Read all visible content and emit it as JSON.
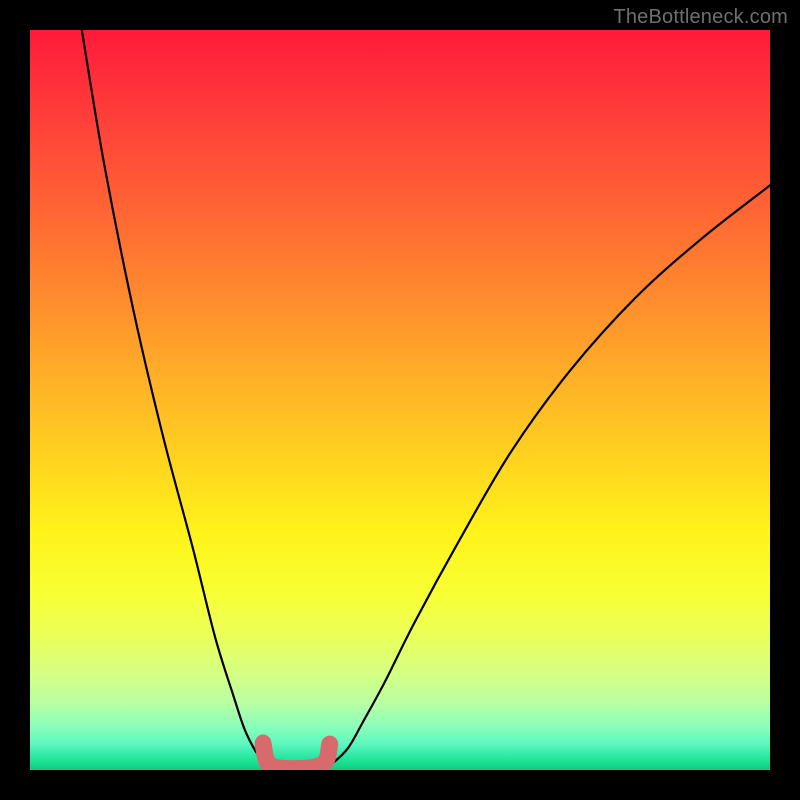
{
  "watermark": "TheBottleneck.com",
  "colors": {
    "background": "#000000",
    "curve": "#000000",
    "marker": "#d86a6d",
    "gradient_top": "#ff1a3a",
    "gradient_mid": "#fff31a",
    "gradient_bottom": "#14c97f"
  },
  "chart_data": {
    "type": "line",
    "title": "",
    "xlabel": "",
    "ylabel": "",
    "xlim": [
      0,
      100
    ],
    "ylim": [
      0,
      100
    ],
    "grid": false,
    "annotations": [],
    "series": [
      {
        "name": "left-curve",
        "x": [
          7,
          10,
          14,
          18,
          22,
          25,
          27.5,
          29,
          30.5,
          31.5,
          32,
          32.5
        ],
        "y": [
          100,
          82,
          62,
          45,
          30,
          18,
          10,
          5.5,
          2.5,
          1.2,
          0.7,
          0.5
        ]
      },
      {
        "name": "right-curve",
        "x": [
          40,
          41,
          43,
          45,
          48,
          52,
          58,
          65,
          73,
          82,
          91,
          100
        ],
        "y": [
          0.5,
          1.0,
          3.0,
          6.5,
          12,
          20,
          31,
          43,
          54,
          64,
          72,
          79
        ]
      },
      {
        "name": "bottom-marker-outline",
        "x": [
          31.5,
          32,
          33,
          34.5,
          36.5,
          38.5,
          40,
          40.5
        ],
        "y": [
          3.5,
          1.2,
          0.4,
          0.2,
          0.2,
          0.4,
          1.2,
          3.5
        ]
      }
    ],
    "markers": [
      {
        "name": "left-dot",
        "x": 31.5,
        "y": 3.7,
        "r": 1.1
      }
    ]
  }
}
